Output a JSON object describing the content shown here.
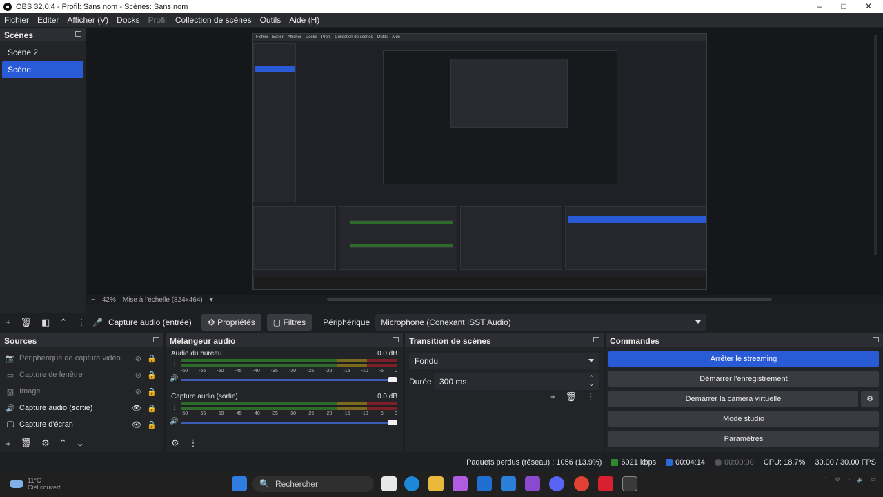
{
  "window": {
    "title": "OBS 32.0.4 - Profil: Sans nom - Scènes: Sans nom"
  },
  "menu": [
    "Fichier",
    "Editer",
    "Afficher (V)",
    "Docks",
    "Profil",
    "Collection de scènes",
    "Outils",
    "Aide (H)"
  ],
  "scenes": {
    "title": "Scènes",
    "items": [
      "Scène 2",
      "Scène"
    ],
    "selected": 1
  },
  "preview": {
    "zoom": "42%",
    "scale_label": "Mise à l'échelle (824x464)"
  },
  "source_toolbar": {
    "source_name": "Capture audio (entrée)",
    "properties": "Propriétés",
    "filters": "Filtres",
    "device_label": "Périphérique",
    "device_value": "Microphone (Conexant ISST Audio)"
  },
  "sources": {
    "title": "Sources",
    "items": [
      {
        "name": "Périphérique de capture vidéo",
        "icon": "camera-icon",
        "visible": false
      },
      {
        "name": "Capture de fenêtre",
        "icon": "window-icon",
        "visible": false
      },
      {
        "name": "Image",
        "icon": "image-icon",
        "visible": false
      },
      {
        "name": "Capture audio (sortie)",
        "icon": "speaker-icon",
        "visible": true
      },
      {
        "name": "Capture d'écran",
        "icon": "monitor-icon",
        "visible": true
      }
    ]
  },
  "mixer": {
    "title": "Mélangeur audio",
    "channels": [
      {
        "name": "Audio du bureau",
        "level": "0.0 dB"
      },
      {
        "name": "Capture audio (sortie)",
        "level": "0.0 dB"
      }
    ],
    "ticks": [
      "-60",
      "-55",
      "-50",
      "-45",
      "-40",
      "-35",
      "-30",
      "-25",
      "-20",
      "-15",
      "-10",
      "-5",
      "0"
    ]
  },
  "transitions": {
    "title": "Transition de scènes",
    "type": "Fondu",
    "duration_label": "Durée",
    "duration_value": "300 ms"
  },
  "commands": {
    "title": "Commandes",
    "stop_streaming": "Arrêter le streaming",
    "start_recording": "Démarrer l'enregistrement",
    "start_virtual_cam": "Démarrer la caméra virtuelle",
    "studio_mode": "Mode studio",
    "settings": "Paramètres"
  },
  "status": {
    "dropped": "Paquets perdus (réseau) : 1056 (13.9%)",
    "bitrate": "6021 kbps",
    "live_time": "00:04:14",
    "rec_time": "00:00:00",
    "cpu": "CPU: 18.7%",
    "fps": "30.00 / 30.00 FPS"
  },
  "taskbar": {
    "temp": "11°C",
    "weather": "Ciel couvert",
    "search_placeholder": "Rechercher"
  },
  "colors": {
    "accent": "#2a5bd7",
    "panel": "#232428",
    "bg": "#1e1f22"
  }
}
